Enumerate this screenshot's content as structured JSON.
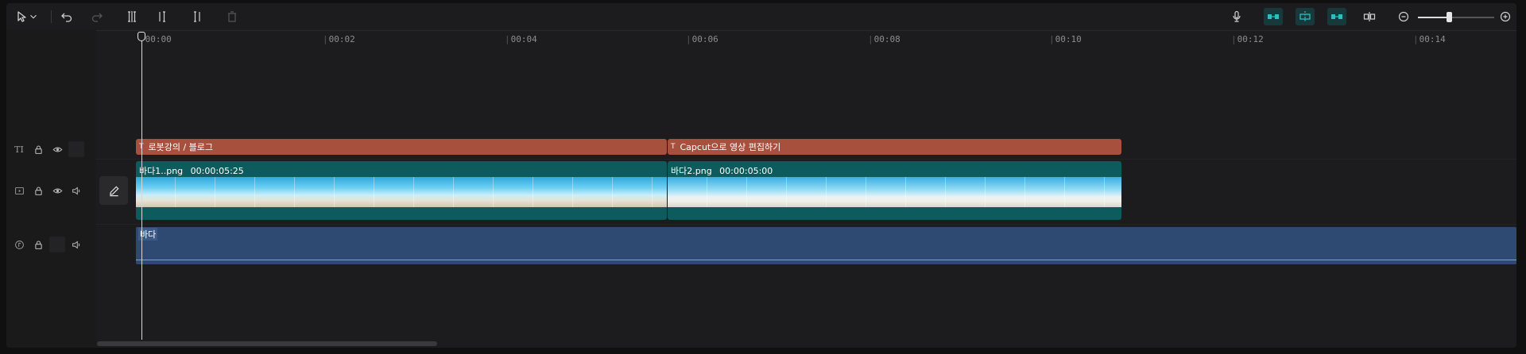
{
  "toolbar": {
    "left_icons": [
      "select-pointer-icon",
      "dropdown-chevron-icon",
      "undo-icon",
      "redo-icon",
      "split-icon",
      "delete-left-icon",
      "delete-right-icon",
      "delete-icon"
    ],
    "right_icons": [
      "microphone-icon",
      "main-track-magnet-icon",
      "auto-snap-icon",
      "linkage-icon",
      "preview-axis-icon",
      "zoom-out-icon",
      "zoom-in-icon"
    ],
    "zoom_level": 0.4
  },
  "ruler": {
    "ticks": [
      "00:00",
      "00:02",
      "00:04",
      "00:06",
      "00:08",
      "00:10",
      "00:12",
      "00:14"
    ]
  },
  "tracks": {
    "text_track_icon": "TI",
    "text_clips": [
      {
        "icon": "T",
        "label": "로봇강의 / 블로그"
      },
      {
        "icon": "T",
        "label": "Capcut으로 영상 편집하기"
      }
    ],
    "video_clips": [
      {
        "name": "바다1..png",
        "duration": "00:00:05:25"
      },
      {
        "name": "바다2.png",
        "duration": "00:00:05:00"
      }
    ],
    "audio_clips": [
      {
        "name": "바다"
      }
    ]
  },
  "colors": {
    "text_clip": "#a8503e",
    "video_clip": "#0e5b5e",
    "audio_clip": "#2e4a72",
    "accent": "#27c1c4"
  }
}
